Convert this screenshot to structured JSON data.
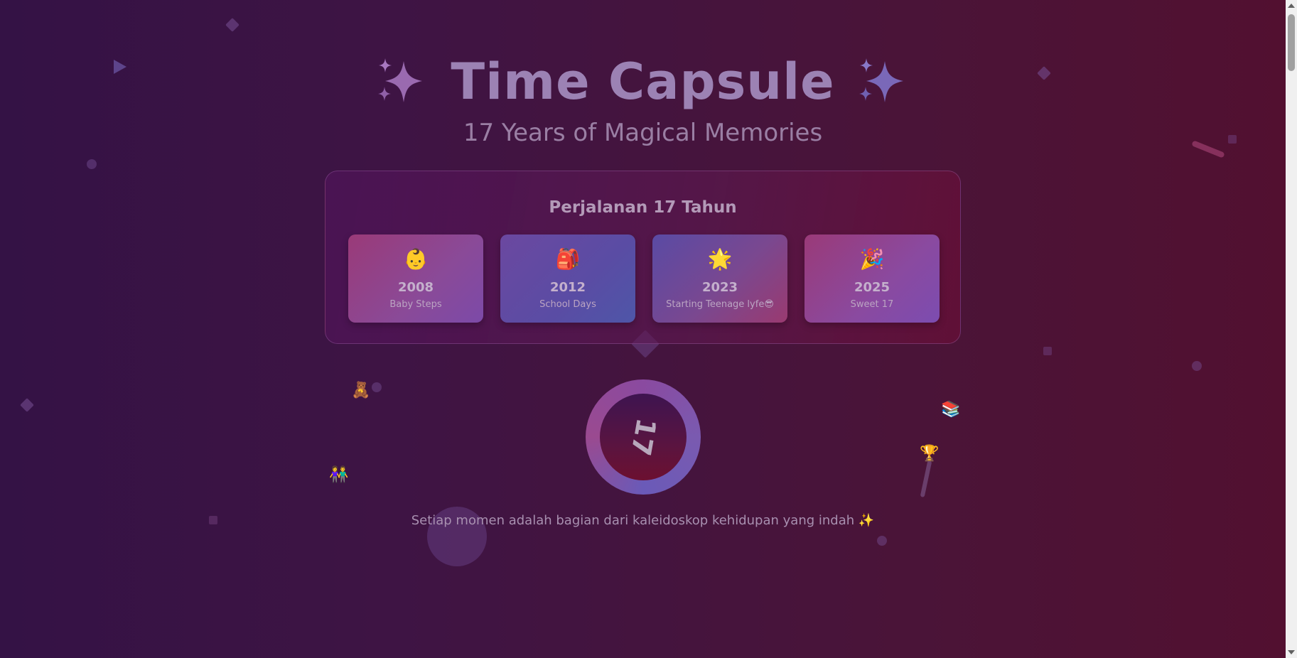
{
  "header": {
    "title": "Time Capsule",
    "subtitle": "17 Years of Magical Memories",
    "left_icon": "sparkles-icon",
    "right_icon": "sparkles-icon"
  },
  "journey": {
    "title": "Perjalanan 17 Tahun",
    "cards": [
      {
        "emoji": "👶",
        "year": "2008",
        "label": "Baby Steps"
      },
      {
        "emoji": "🎒",
        "year": "2012",
        "label": "School Days"
      },
      {
        "emoji": "🌟",
        "year": "2023",
        "label": "Starting Teenage lyfe😎"
      },
      {
        "emoji": "🎉",
        "year": "2025",
        "label": "Sweet 17"
      }
    ]
  },
  "floating": {
    "teddy": "🧸",
    "friends": "👫",
    "books": "📚",
    "trophy": "🏆"
  },
  "ring": {
    "number": "17"
  },
  "quote": "Setiap momen adalah bagian dari kaleidoskop kehidupan yang indah ✨",
  "colors": {
    "title": "#9c82b4",
    "background_left": "#341245",
    "background_right": "#521030"
  }
}
